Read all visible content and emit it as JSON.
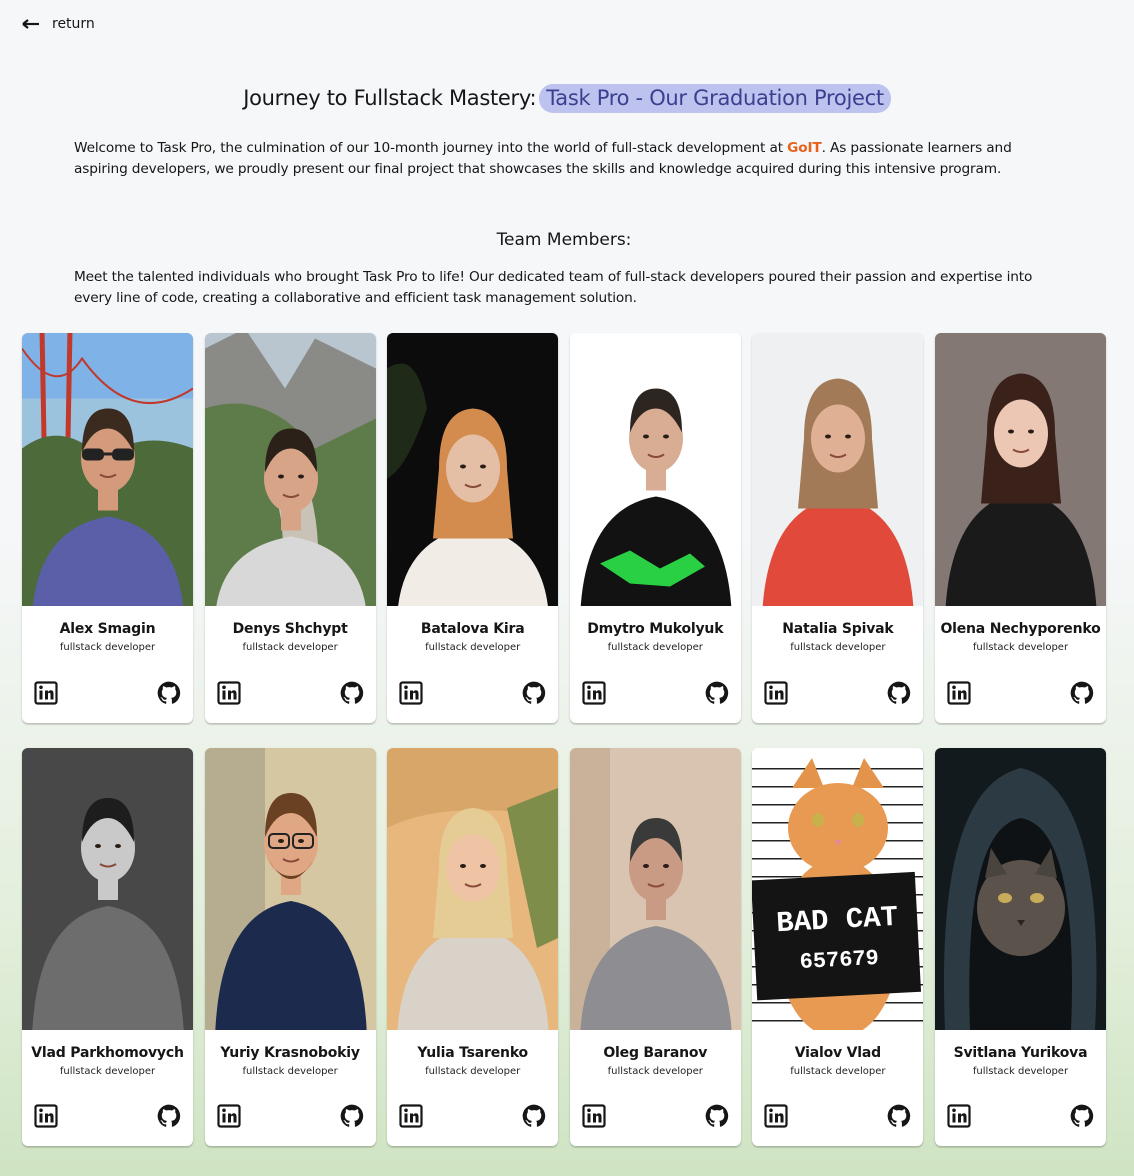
{
  "nav": {
    "return_label": "return"
  },
  "hero": {
    "title_prefix": "Journey to Fullstack Mastery:",
    "title_highlight": "Task Pro - Our Graduation Project",
    "intro_before": "Welcome to Task Pro, the culmination of our 10-month journey into the world of full-stack development at ",
    "intro_brand": "GoIT",
    "intro_after": ". As passionate learners and aspiring developers, we proudly present our final project that showcases the skills and knowledge acquired during this intensive program."
  },
  "team": {
    "heading": "Team Members:",
    "description": "Meet the talented individuals who brought Task Pro to life! Our dedicated team of full-stack developers poured their passion and expertise into every line of code, creating a collaborative and efficient task management solution.",
    "members": [
      {
        "name": "Alex Smagin",
        "role": "fullstack developer",
        "photo": "man-sunglasses-golden-gate"
      },
      {
        "name": "Denys Shchypt",
        "role": "fullstack developer",
        "photo": "man-mountain-canyon"
      },
      {
        "name": "Batalova Kira",
        "role": "fullstack developer",
        "photo": "woman-dark-background"
      },
      {
        "name": "Dmytro Mukolyuk",
        "role": "fullstack developer",
        "photo": "man-white-background"
      },
      {
        "name": "Natalia Spivak",
        "role": "fullstack developer",
        "photo": "woman-red-shirt"
      },
      {
        "name": "Olena Nechyporenko",
        "role": "fullstack developer",
        "photo": "woman-black-top"
      },
      {
        "name": "Vlad Parkhomovych",
        "role": "fullstack developer",
        "photo": "man-black-white"
      },
      {
        "name": "Yuriy Krasnobokiy",
        "role": "fullstack developer",
        "photo": "man-glasses-beard"
      },
      {
        "name": "Yulia Tsarenko",
        "role": "fullstack developer",
        "photo": "woman-desert"
      },
      {
        "name": "Oleg Baranov",
        "role": "fullstack developer",
        "photo": "man-grey-sweater"
      },
      {
        "name": "Vialov Vlad",
        "role": "fullstack developer",
        "photo": "cat-mugshot"
      },
      {
        "name": "Svitlana Yurikova",
        "role": "fullstack developer",
        "photo": "cat-hood"
      }
    ]
  },
  "mugshot_sign": {
    "line1": "BAD CAT",
    "line2": "657679"
  },
  "icons": {
    "linkedin": "linkedin-icon",
    "github": "github-icon",
    "return": "arrow-left-icon"
  },
  "colors": {
    "accent_highlight": "#bec2ee",
    "accent_text": "#3b3f8f",
    "brand": "#e8621f",
    "background_top": "#f6f7f9",
    "background_bottom": "#cfe4c3"
  }
}
